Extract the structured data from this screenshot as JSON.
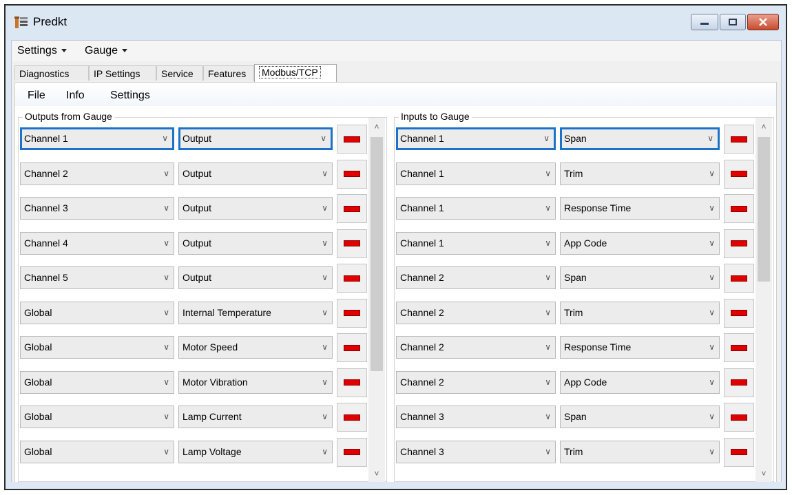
{
  "window": {
    "title": "Predkt"
  },
  "menubar": {
    "items": [
      "Settings",
      "Gauge"
    ]
  },
  "tabs": [
    "Diagnostics",
    "IP Settings",
    "Service",
    "Features",
    "Modbus/TCP"
  ],
  "active_tab": "Modbus/TCP",
  "submenu": {
    "items": [
      "File",
      "Info",
      "Settings"
    ]
  },
  "outputs": {
    "label": "Outputs from Gauge",
    "rows": [
      {
        "channel": "Channel 1",
        "value": "Output"
      },
      {
        "channel": "Channel 2",
        "value": "Output"
      },
      {
        "channel": "Channel 3",
        "value": "Output"
      },
      {
        "channel": "Channel 4",
        "value": "Output"
      },
      {
        "channel": "Channel 5",
        "value": "Output"
      },
      {
        "channel": "Global",
        "value": "Internal Temperature"
      },
      {
        "channel": "Global",
        "value": "Motor Speed"
      },
      {
        "channel": "Global",
        "value": "Motor Vibration"
      },
      {
        "channel": "Global",
        "value": "Lamp Current"
      },
      {
        "channel": "Global",
        "value": "Lamp Voltage"
      }
    ]
  },
  "inputs": {
    "label": "Inputs to Gauge",
    "rows": [
      {
        "channel": "Channel 1",
        "value": "Span"
      },
      {
        "channel": "Channel 1",
        "value": "Trim"
      },
      {
        "channel": "Channel 1",
        "value": "Response Time"
      },
      {
        "channel": "Channel 1",
        "value": "App Code"
      },
      {
        "channel": "Channel 2",
        "value": "Span"
      },
      {
        "channel": "Channel 2",
        "value": "Trim"
      },
      {
        "channel": "Channel 2",
        "value": "Response Time"
      },
      {
        "channel": "Channel 2",
        "value": "App Code"
      },
      {
        "channel": "Channel 3",
        "value": "Span"
      },
      {
        "channel": "Channel 3",
        "value": "Trim"
      }
    ]
  },
  "icons": {
    "dropdown": "chevron-down-icon",
    "remove": "remove-icon",
    "scroll_up": "scroll-up-icon",
    "scroll_down": "scroll-down-icon"
  },
  "colors": {
    "selection": "#1a73c8",
    "remove": "#e00000"
  }
}
